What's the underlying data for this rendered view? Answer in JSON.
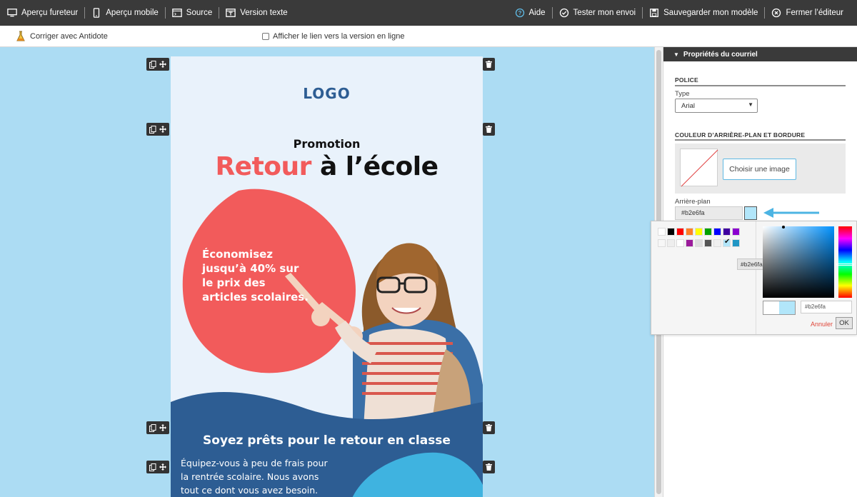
{
  "toolbar": {
    "left": [
      {
        "id": "browser-preview",
        "label": "Aperçu fureteur"
      },
      {
        "id": "mobile-preview",
        "label": "Aperçu mobile"
      },
      {
        "id": "source",
        "label": "Source"
      },
      {
        "id": "text-version",
        "label": "Version texte"
      }
    ],
    "right": [
      {
        "id": "help",
        "label": "Aide"
      },
      {
        "id": "test-send",
        "label": "Tester mon envoi"
      },
      {
        "id": "save-template",
        "label": "Sauvegarder mon modèle"
      },
      {
        "id": "close-editor",
        "label": "Fermer l’éditeur"
      }
    ]
  },
  "subbar": {
    "antidote_label": "Corriger avec Antidote",
    "online_link_label": "Afficher le lien vers la version en ligne"
  },
  "email": {
    "logo": "LOGO",
    "promo": "Promotion",
    "headline_red": "Retour",
    "headline_rest": " à l’école",
    "offer": "Économisez jusqu’à 40% sur le prix des articles scolaires.",
    "bottom_title": "Soyez prêts pour le retour en classe",
    "bottom_body": "Équipez-vous à peu de frais pour la rentrée scolaire. Nous avons tout ce dont vous avez besoin.",
    "colors": {
      "background": "#e9f2fb",
      "blob": "#f25b5b",
      "wave": "#2d5d93",
      "accent": "#3fb3e0"
    }
  },
  "panel": {
    "header": "Propriétés du courriel",
    "font_section": "POLICE",
    "type_label": "Type",
    "type_value": "Arial",
    "bg_section": "COULEUR D’ARRIÈRE-PLAN ET BORDURE",
    "choose_image": "Choisir une image",
    "bg_label": "Arrière-plan",
    "bg_value": "#b2e6fa"
  },
  "picker": {
    "tooltip": "#b2e6fa",
    "hex_value": "#b2e6fa",
    "cancel": "Annuler",
    "ok": "OK",
    "palette_row1": [
      "#ffffff",
      "#000000",
      "#ff0000",
      "#ff7f27",
      "#ffff00",
      "#00a000",
      "#0000ff",
      "#3f00a0",
      "#8b00d0"
    ],
    "palette_row2": [
      "#f7f7f7",
      "#eeeeee",
      "#ffffff",
      "#9b1b9b",
      "#dddddd",
      "#555555",
      "#f0f0f0",
      "#b2e6fa",
      "#2196c4"
    ],
    "previous_color": "#ffffff",
    "current_color": "#b2e6fa"
  },
  "canvas_color": "#acdcf3"
}
